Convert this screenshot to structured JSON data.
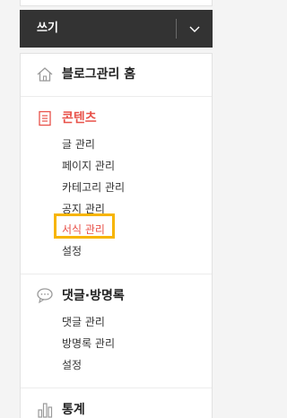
{
  "write_button": {
    "label": "쓰기"
  },
  "menu": {
    "blog_home": {
      "label": "블로그관리 홈"
    },
    "contents": {
      "label": "콘텐츠",
      "items": [
        "글 관리",
        "페이지 관리",
        "카테고리 관리",
        "공지 관리",
        "서식 관리",
        "설정"
      ],
      "selected_item": "서식 관리"
    },
    "comments": {
      "label": "댓글·방명록",
      "items": [
        "댓글 관리",
        "방명록 관리",
        "설정"
      ]
    },
    "stats": {
      "label": "통계"
    }
  },
  "colors": {
    "active": "#e8524a",
    "highlight": "#f7b500",
    "button_bg": "#333333"
  }
}
